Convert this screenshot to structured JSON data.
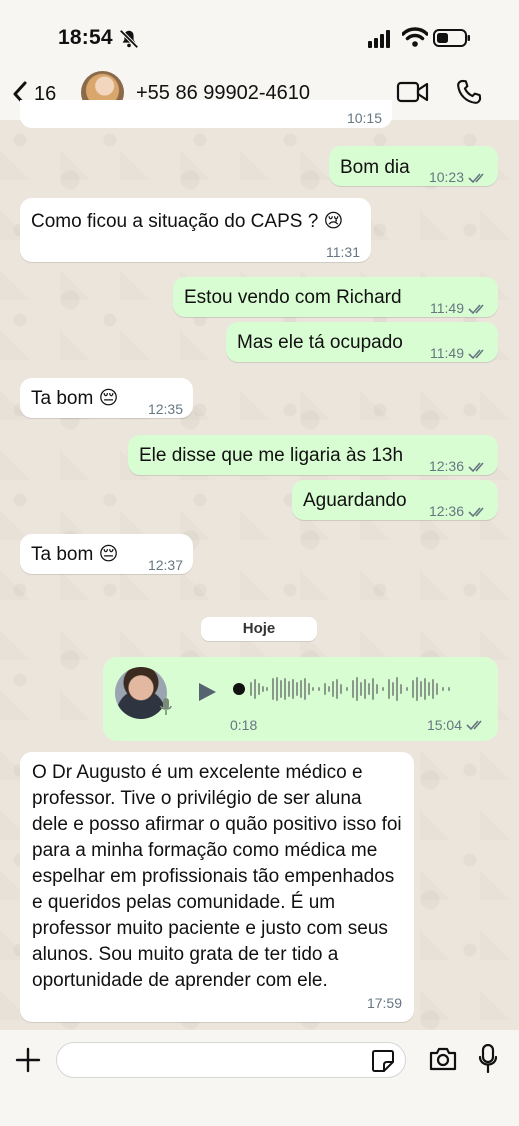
{
  "status": {
    "time": "18:54"
  },
  "header": {
    "back_count": "16",
    "contact": "+55 86 99902-4610"
  },
  "messages": [
    {
      "dir": "in",
      "text": "",
      "time": "10:15",
      "partial": true
    },
    {
      "dir": "out",
      "text": "Bom dia",
      "time": "10:23"
    },
    {
      "dir": "in",
      "text": "Como ficou a situação do CAPS ? 😢",
      "time": "11:31"
    },
    {
      "dir": "out",
      "text": "Estou vendo com Richard",
      "time": "11:49"
    },
    {
      "dir": "out",
      "text": "Mas ele tá ocupado",
      "time": "11:49"
    },
    {
      "dir": "in",
      "text": "Ta bom 😔",
      "time": "12:35"
    },
    {
      "dir": "out",
      "text": "Ele disse que me ligaria às 13h",
      "time": "12:36"
    },
    {
      "dir": "out",
      "text": "Aguardando",
      "time": "12:36"
    },
    {
      "dir": "in",
      "text": "Ta bom 😔",
      "time": "12:37"
    }
  ],
  "date_chip": "Hoje",
  "voice_note": {
    "duration": "0:18",
    "time": "15:04"
  },
  "long_message": {
    "text": "O Dr Augusto é um excelente médico e professor. Tive o privilégio de ser aluna dele e posso afirmar o quão positivo isso foi para a minha formação como médica me espelhar em profissionais tão empenhados e queridos pelas comunidade. É um professor muito paciente e justo com seus alunos. Sou muito grata de ter tido a oportunidade de aprender com ele.",
    "time": "17:59"
  },
  "input": {
    "placeholder": ""
  },
  "colors": {
    "outgoing": "#d9fdd3",
    "incoming": "#ffffff",
    "tick": "#667781"
  },
  "icons": [
    "bell-slash-icon",
    "signal-icon",
    "wifi-icon",
    "battery-icon",
    "back-chevron-icon",
    "video-call-icon",
    "phone-icon",
    "play-icon",
    "microphone-icon",
    "plus-icon",
    "sticker-icon",
    "camera-icon"
  ]
}
